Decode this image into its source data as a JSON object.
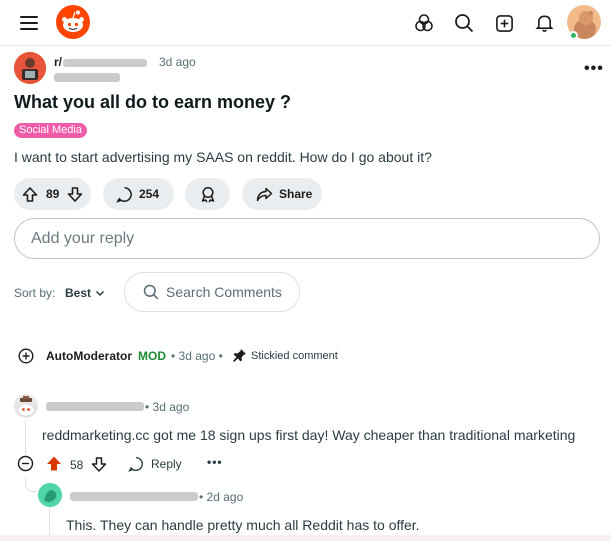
{
  "header": {
    "menu_icon": "hamburger-icon",
    "logo": "reddit-logo",
    "icons": [
      "apps-icon",
      "search-icon",
      "create-post-icon",
      "notifications-icon"
    ],
    "avatar": "user-avatar"
  },
  "post": {
    "subreddit_prefix": "r/",
    "time": "3d ago",
    "more": "•••",
    "title": "What you all do to earn money ?",
    "flair": "Social Media",
    "body": "I want to start advertising my SAAS on reddit. How do I go about it?",
    "score": "89",
    "comments": "254",
    "share_label": "Share",
    "colors": {
      "flair": "#ef5da8",
      "pill": "#eaedef"
    }
  },
  "reply_box": {
    "placeholder": "Add your reply"
  },
  "sort": {
    "label": "Sort by:",
    "value": "Best"
  },
  "search_comments": {
    "placeholder": "Search Comments"
  },
  "automod": {
    "name": "AutoModerator",
    "badge": "MOD",
    "time": "• 3d ago •",
    "stickied": "Stickied comment"
  },
  "comments": [
    {
      "time": "• 3d ago",
      "body": "reddmarketing.cc got me 18 sign ups first day! Way cheaper than traditional marketing",
      "score": "58",
      "reply_label": "Reply",
      "more": "•••",
      "upvoted": true,
      "upvote_color": "#d93900"
    },
    {
      "time": "• 2d ago",
      "body": "This. They can handle pretty much all Reddit has to offer."
    }
  ]
}
